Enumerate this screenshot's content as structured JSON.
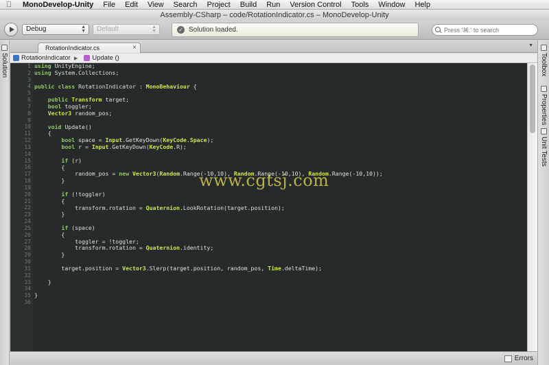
{
  "menubar": {
    "apple": "",
    "app_name": "MonoDevelop-Unity",
    "items": [
      "File",
      "Edit",
      "View",
      "Search",
      "Project",
      "Build",
      "Run",
      "Version Control",
      "Tools",
      "Window",
      "Help"
    ]
  },
  "window": {
    "title": "Assembly-CSharp – code/RotationIndicator.cs – MonoDevelop-Unity"
  },
  "toolbar": {
    "config_value": "Debug",
    "platform_value": "Default",
    "status_message": "Solution loaded.",
    "search_placeholder": "Press '⌘.' to search"
  },
  "pads": {
    "left": [
      "Solution"
    ],
    "right": [
      "Toolbox",
      "Properties",
      "Unit Tests"
    ]
  },
  "tabs": [
    {
      "label": "RotationIndicator.cs",
      "close": "×"
    }
  ],
  "breadcrumb": {
    "class_name": "RotationIndicator",
    "sep": "▶",
    "method_name": "Update ()"
  },
  "editor": {
    "line_numbers": [
      "1",
      "2",
      "3",
      "4",
      "5",
      "6",
      "7",
      "8",
      "9",
      "10",
      "11",
      "12",
      "13",
      "14",
      "15",
      "16",
      "17",
      "18",
      "19",
      "20",
      "21",
      "22",
      "23",
      "24",
      "25",
      "26",
      "27",
      "28",
      "29",
      "30",
      "31",
      "32",
      "33",
      "34",
      "35",
      "36"
    ]
  },
  "watermark": "www.cgtsj.com",
  "statusbar": {
    "errors_label": "Errors"
  },
  "colors": {
    "editor_bg": "#262a2b",
    "keyword": "#93c763",
    "type": "#d2e641",
    "text": "#e0e0d6"
  }
}
